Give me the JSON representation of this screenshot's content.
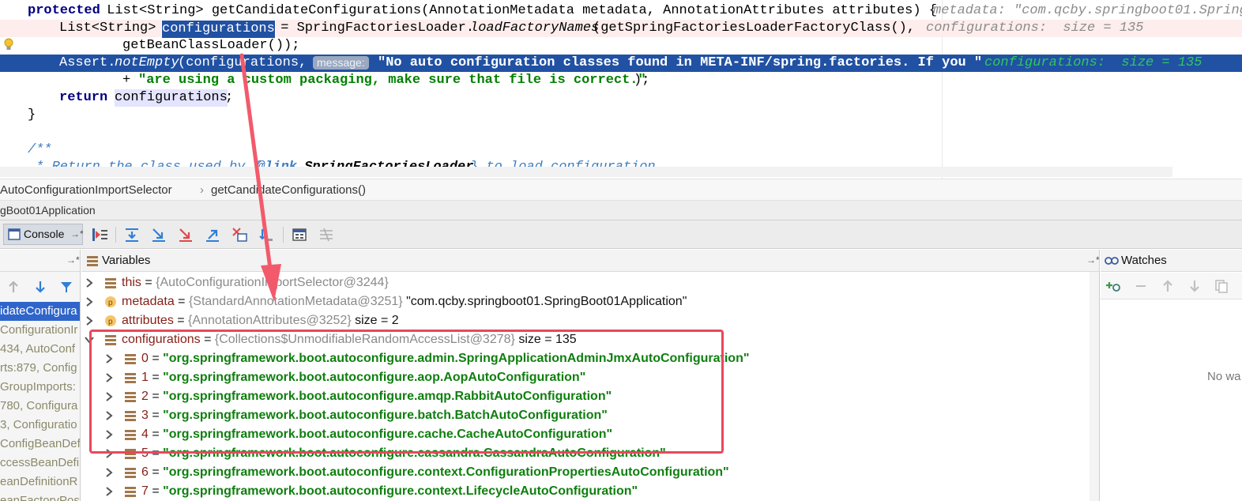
{
  "editor": {
    "line1": {
      "kw": "protected",
      "text": " List<String> getCandidateConfigurations(AnnotationMetadata metadata, AnnotationAttributes attributes) {",
      "inline": "metadata: \"com.qcby.springboot01.Spring"
    },
    "line2": {
      "prefix": "List<String> ",
      "var": "configurations",
      "middle": " = SpringFactoriesLoader.",
      "method": "loadFactoryNames",
      "rest": "(getSpringFactoriesLoaderFactoryClass(),",
      "inline": "configurations:  size = 135"
    },
    "line3": {
      "text": "getBeanClassLoader());"
    },
    "line4": {
      "prefix": "Assert.",
      "method": "notEmpty",
      "args": "(configurations,",
      "hint": "message:",
      "string": "\"No auto configuration classes found in META-INF/spring.factories. If you \"",
      "inline": "configurations:  size = 135"
    },
    "line5": {
      "plus": "+ ",
      "string": "\"are using a custom packaging, make sure that file is correct.\"",
      "end": ");"
    },
    "line6": {
      "kw": "return",
      "var": "configurations",
      "end": ";"
    },
    "line7": {
      "text": "}"
    },
    "line8": {
      "text": "/**"
    },
    "line9": {
      "star": " * Return the class used by {",
      "tag": "@link",
      "ref": " SpringFactoriesLoader",
      "rest": "} to load configuration"
    }
  },
  "breadcrumb": {
    "class_name": "AutoConfigurationImportSelector",
    "sep": "›",
    "method": "getCandidateConfigurations()"
  },
  "run_config": "gBoot01Application",
  "toolbar": {
    "console_label": "Console",
    "console_pin": "→*"
  },
  "frames": {
    "pin": "→*",
    "items": [
      "idateConfigura",
      "ConfigurationIr",
      "434, AutoConf",
      "rts:879, Config",
      "GroupImports:",
      "780, Configura",
      "3, Configuratio",
      "ConfigBeanDef",
      "ccessBeanDefini",
      "eanDefinitionR",
      "eanFactoryPos"
    ]
  },
  "variables": {
    "title": "Variables",
    "pin": "→*",
    "rows": [
      {
        "name": "this",
        "eq": " = ",
        "type": "{AutoConfigurationImportSelector@3244}",
        "extra": ""
      },
      {
        "name": "metadata",
        "eq": " = ",
        "type": "{StandardAnnotationMetadata@3251}",
        "extra": " \"com.qcby.springboot01.SpringBoot01Application\""
      },
      {
        "name": "attributes",
        "eq": " = ",
        "type": "{AnnotationAttributes@3252}",
        "extra": "  size = 2"
      },
      {
        "name": "configurations",
        "eq": " = ",
        "type": "{Collections$UnmodifiableRandomAccessList@3278}",
        "extra": "  size = 135"
      }
    ],
    "children": [
      {
        "idx": "0",
        "eq": " = ",
        "value": "\"org.springframework.boot.autoconfigure.admin.SpringApplicationAdminJmxAutoConfiguration\""
      },
      {
        "idx": "1",
        "eq": " = ",
        "value": "\"org.springframework.boot.autoconfigure.aop.AopAutoConfiguration\""
      },
      {
        "idx": "2",
        "eq": " = ",
        "value": "\"org.springframework.boot.autoconfigure.amqp.RabbitAutoConfiguration\""
      },
      {
        "idx": "3",
        "eq": " = ",
        "value": "\"org.springframework.boot.autoconfigure.batch.BatchAutoConfiguration\""
      },
      {
        "idx": "4",
        "eq": " = ",
        "value": "\"org.springframework.boot.autoconfigure.cache.CacheAutoConfiguration\""
      },
      {
        "idx": "5",
        "eq": " = ",
        "value": "\"org.springframework.boot.autoconfigure.cassandra.CassandraAutoConfiguration\""
      },
      {
        "idx": "6",
        "eq": " = ",
        "value": "\"org.springframework.boot.autoconfigure.context.ConfigurationPropertiesAutoConfiguration\""
      },
      {
        "idx": "7",
        "eq": " = ",
        "value": "\"org.springframework.boot.autoconfigure.context.LifecycleAutoConfiguration\""
      }
    ]
  },
  "watches": {
    "title": "Watches",
    "empty_text": "No wa"
  },
  "colors": {
    "selection": "#2151a3",
    "annotation": "#e8495c",
    "string": "#0f7f0f",
    "var_name": "#861f16"
  }
}
